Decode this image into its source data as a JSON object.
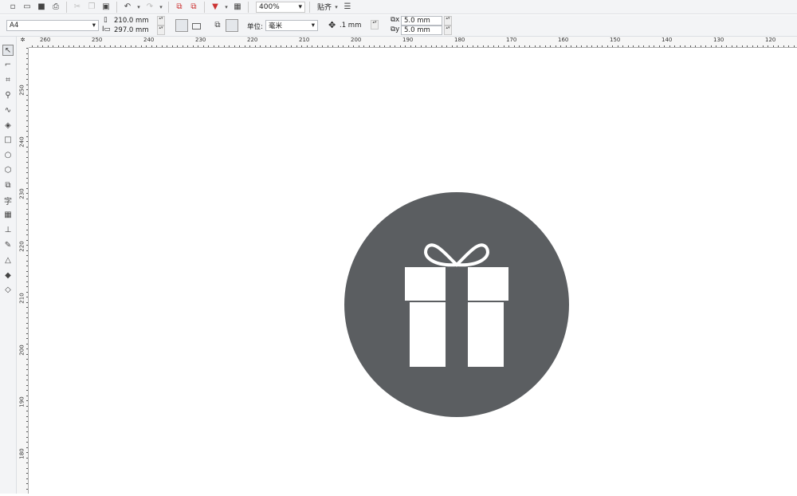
{
  "toolbar": {
    "zoom": "400%",
    "snap_label": "贴齐",
    "icons": [
      "new-icon",
      "open-icon",
      "save-icon",
      "print-icon",
      "cut-icon",
      "copy-icon",
      "paste-icon",
      "undo-icon",
      "redo-icon",
      "import-icon",
      "export-icon",
      "publish-icon",
      "app-launcher-icon"
    ]
  },
  "property_bar": {
    "page_size": "A4",
    "width": "210.0 mm",
    "height": "297.0 mm",
    "unit_label": "单位:",
    "unit": "毫米",
    "nudge": ".1 mm",
    "dup_x": "5.0 mm",
    "dup_y": "5.0 mm"
  },
  "tools": [
    "pick-tool",
    "shape-tool",
    "crop-tool",
    "zoom-tool",
    "freehand-tool",
    "smart-fill-tool",
    "rectangle-tool",
    "ellipse-tool",
    "polygon-tool",
    "basic-shapes-tool",
    "text-tool",
    "table-tool",
    "dimension-tool",
    "eyedropper-tool",
    "outline-tool",
    "fill-tool",
    "interactive-fill-tool"
  ],
  "ruler_top": [
    "260",
    "250",
    "240",
    "230",
    "220",
    "210",
    "200",
    "190",
    "180",
    "170",
    "160",
    "150",
    "140",
    "130",
    "120"
  ],
  "ruler_left": [
    "250",
    "240",
    "230",
    "220",
    "210",
    "200",
    "190",
    "180"
  ],
  "drawing": {
    "circle_color": "#5b5e61",
    "gift_color": "#ffffff"
  }
}
